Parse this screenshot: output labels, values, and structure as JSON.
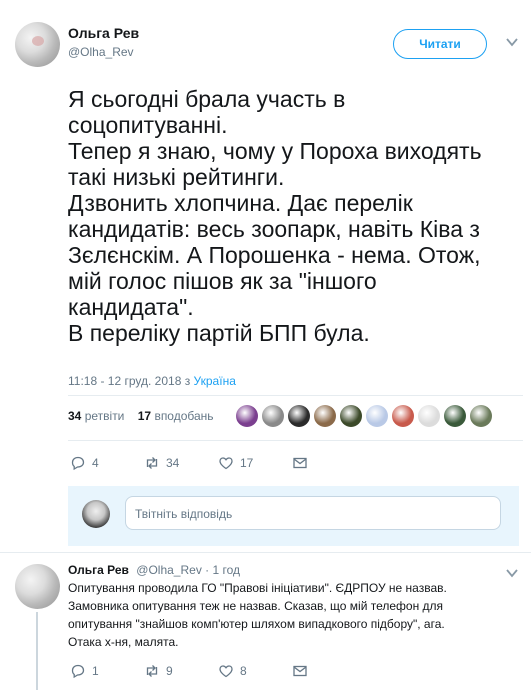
{
  "tweet": {
    "display_name": "Ольга Рев",
    "handle": "@Olha_Rev",
    "follow_label": "Читати",
    "text": "Я сьогодні брала участь в\nсоцопитуванні.\nТепер я знаю, чому у Пороха виходять\nтакі низькі рейтинги.\nДзвонить хлопчина. Дає перелік\nкандидатів: весь зоопарк, навіть Ківа з\nЗєлєнскім. А Порошенка - нема. Отож,\nмій голос пішов як за \"іншого\nкандидата\".\nВ переліку партій БПП була.",
    "timestamp": "11:18 - 12 груд. 2018 з",
    "location": "Україна",
    "retweets_count": "34",
    "retweets_label": "ретвіти",
    "likes_count": "17",
    "likes_label": "вподобань",
    "liker_colors": [
      "#7b3f8f",
      "#8a8a8a",
      "#2b2b2b",
      "#8b6a4a",
      "#3c4a2a",
      "#b9c9e6",
      "#c85a4c",
      "#dcdcdc",
      "#3a5a3a",
      "#6a7a5a"
    ],
    "actions": {
      "replies": "4",
      "retweets": "34",
      "likes": "17"
    }
  },
  "reply_composer": {
    "placeholder": "Твітніть відповідь"
  },
  "reply_tweet": {
    "display_name": "Ольга Рев",
    "handle": "@Olha_Rev",
    "separator": "·",
    "time": "1 год",
    "text": "Опитування проводила ГО \"Правові ініціативи\". ЄДРПОУ не назвав.\nЗамовника опитування теж не назвав. Сказав, що мій телефон для\nопитування \"знайшов комп'ютер шляхом випадкового підбору\", ага.\nОтака х-ня, малята.",
    "actions": {
      "replies": "1",
      "retweets": "9",
      "likes": "8"
    }
  },
  "colors": {
    "accent": "#1da1f2",
    "secondary_text": "#657786",
    "divider": "#e6ecf0",
    "composer_bg": "#e8f5fd"
  },
  "icons": [
    "chevron-down-icon",
    "reply-icon",
    "retweet-icon",
    "like-icon",
    "message-icon"
  ]
}
